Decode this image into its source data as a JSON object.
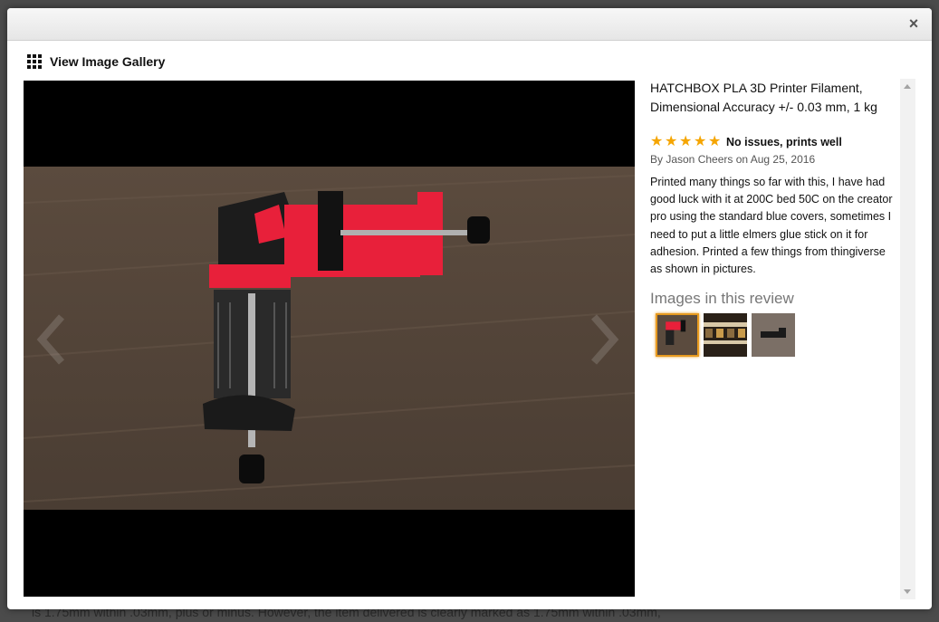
{
  "background_text": "is 1.75mm within .03mm, plus or minus. However, the item delivered is clearly marked as 1.75mm within .03mm,",
  "modal": {
    "close_label": "×",
    "gallery_link_label": "View Image Gallery"
  },
  "product": {
    "title": "HATCHBOX PLA 3D Printer Filament, Dimensional Accuracy +/- 0.03 mm, 1 kg"
  },
  "review": {
    "rating": 5,
    "rating_max": 5,
    "title": "No issues, prints well",
    "byline": "By Jason Cheers on Aug 25, 2016",
    "body": "Printed many things so far with this, I have had good luck with it at 200C bed 50C on the creator pro using the standard blue covers, sometimes I need to put a little elmers glue stick on it for adhesion. Printed a few things from thingiverse as shown in pictures."
  },
  "images_section": {
    "heading": "Images in this review",
    "thumbnails": [
      {
        "subject": "red and black printed clamp",
        "selected": true
      },
      {
        "subject": "shelf with spools",
        "selected": false
      },
      {
        "subject": "black printed part on table",
        "selected": false
      }
    ]
  },
  "colors": {
    "accent_selected_thumb": "#e79a1f",
    "star": "#f5a500",
    "viewer_background": "#000000",
    "print_red": "#e8203a"
  },
  "icons": {
    "gallery": "grid-icon",
    "close": "close-icon",
    "prev": "chevron-left-icon",
    "next": "chevron-right-icon",
    "star": "star-icon"
  }
}
